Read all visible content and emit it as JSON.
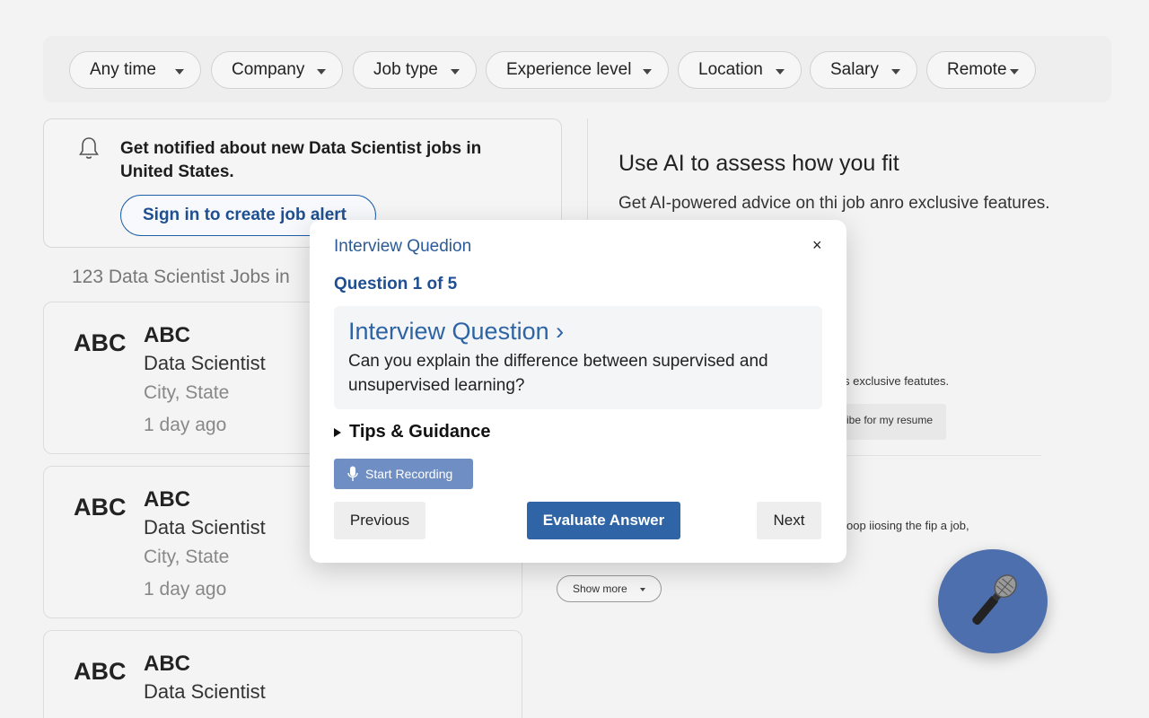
{
  "filters": [
    {
      "label": "Any time"
    },
    {
      "label": "Company"
    },
    {
      "label": "Job type"
    },
    {
      "label": "Experience level"
    },
    {
      "label": "Location"
    },
    {
      "label": "Salary"
    },
    {
      "label": "Remote"
    }
  ],
  "alert": {
    "message": "Get notified about new Data Scientist jobs in United States.",
    "signin_label": "Sign in to create job alert"
  },
  "results_count": "123 Data Scientist Jobs in",
  "jobs": [
    {
      "logo": "ABC",
      "company": "ABC",
      "title": "Data Scientist",
      "location": "City, State",
      "posted": "1 day ago"
    },
    {
      "logo": "ABC",
      "company": "ABC",
      "title": "Data Scientist",
      "location": "City, State",
      "posted": "1 day ago"
    },
    {
      "logo": "ABC",
      "company": "ABC",
      "title": "Data Scientist"
    }
  ],
  "ai_panel": {
    "title": "Use AI to assess how you fit",
    "subtitle": "Get AI-powered advice on thi job anro exclusive features.",
    "bg_text_1": "s exclusive featutes.",
    "bg_button": "ibe for my resume",
    "bg_text_2": "oop iiosing the fip a job,",
    "show_more": "Show more"
  },
  "modal": {
    "title": "Interview Quedion",
    "close": "×",
    "question_number": "Question 1 of 5",
    "question_heading": "Interview Question ›",
    "question_text": "Can you explain the difference between supervised and unsupervised learning?",
    "tips_label": "Tips & Guidance",
    "record_label": "Start Recording",
    "previous_label": "Previous",
    "evaluate_label": "Evaluate Answer",
    "next_label": "Next"
  },
  "colors": {
    "accent": "#2f64a6",
    "fab": "#4e6fae",
    "record": "#6f8fc4"
  },
  "icons": {
    "alert": "bell-icon",
    "record": "microphone-icon",
    "fab": "microphone-icon"
  }
}
